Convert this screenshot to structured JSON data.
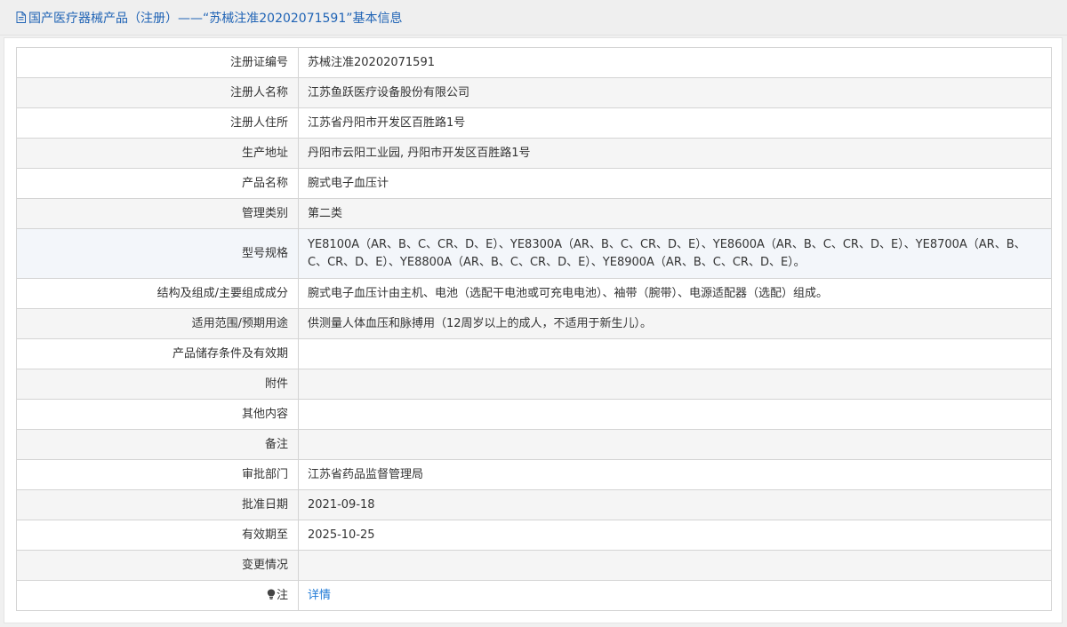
{
  "header": {
    "title": "国产医疗器械产品（注册）——“苏械注准20202071591”基本信息"
  },
  "rows": [
    {
      "label": "注册证编号",
      "value": "苏械注准20202071591"
    },
    {
      "label": "注册人名称",
      "value": "江苏鱼跃医疗设备股份有限公司"
    },
    {
      "label": "注册人住所",
      "value": "江苏省丹阳市开发区百胜路1号"
    },
    {
      "label": "生产地址",
      "value": "丹阳市云阳工业园, 丹阳市开发区百胜路1号"
    },
    {
      "label": "产品名称",
      "value": "腕式电子血压计"
    },
    {
      "label": "管理类别",
      "value": "第二类"
    },
    {
      "label": "型号规格",
      "value": "YE8100A（AR、B、C、CR、D、E）、YE8300A（AR、B、C、CR、D、E）、YE8600A（AR、B、C、CR、D、E）、YE8700A（AR、B、C、CR、D、E）、YE8800A（AR、B、C、CR、D、E）、YE8900A（AR、B、C、CR、D、E）。"
    },
    {
      "label": "结构及组成/主要组成成分",
      "value": "腕式电子血压计由主机、电池（选配干电池或可充电电池）、袖带（腕带）、电源适配器（选配）组成。"
    },
    {
      "label": "适用范围/预期用途",
      "value": "供测量人体血压和脉搏用（12周岁以上的成人，不适用于新生儿）。"
    },
    {
      "label": "产品储存条件及有效期",
      "value": ""
    },
    {
      "label": "附件",
      "value": ""
    },
    {
      "label": "其他内容",
      "value": ""
    },
    {
      "label": "备注",
      "value": ""
    },
    {
      "label": "审批部门",
      "value": "江苏省药品监督管理局"
    },
    {
      "label": "批准日期",
      "value": "2021-09-18"
    },
    {
      "label": "有效期至",
      "value": "2025-10-25"
    },
    {
      "label": "变更情况",
      "value": ""
    }
  ],
  "note_row": {
    "label": "注",
    "link_text": "详情",
    "icon": "lightbulb-icon"
  },
  "colors": {
    "title": "#1f63b5",
    "link": "#1f7ad6",
    "border": "#d4d4d4"
  }
}
